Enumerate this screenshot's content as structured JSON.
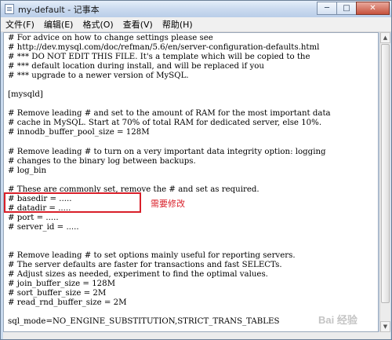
{
  "window": {
    "title": "my-default - 记事本",
    "controls": {
      "minimize": "─",
      "maximize": "□",
      "close": "✕"
    }
  },
  "menu": [
    {
      "label": "文件(F)"
    },
    {
      "label": "编辑(E)"
    },
    {
      "label": "格式(O)"
    },
    {
      "label": "查看(V)"
    },
    {
      "label": "帮助(H)"
    }
  ],
  "editor": {
    "lines": [
      "# For advice on how to change settings please see",
      "# http://dev.mysql.com/doc/refman/5.6/en/server-configuration-defaults.html",
      "# *** DO NOT EDIT THIS FILE. It's a template which will be copied to the",
      "# *** default location during install, and will be replaced if you",
      "# *** upgrade to a newer version of MySQL.",
      "",
      "[mysqld]",
      "",
      "# Remove leading # and set to the amount of RAM for the most important data",
      "# cache in MySQL. Start at 70% of total RAM for dedicated server, else 10%.",
      "# innodb_buffer_pool_size = 128M",
      "",
      "# Remove leading # to turn on a very important data integrity option: logging",
      "# changes to the binary log between backups.",
      "# log_bin",
      "",
      "# These are commonly set, remove the # and set as required.",
      "# basedir = .....",
      "# datadir = .....",
      "# port = .....",
      "# server_id = .....",
      "",
      "",
      "# Remove leading # to set options mainly useful for reporting servers.",
      "# The server defaults are faster for transactions and fast SELECTs.",
      "# Adjust sizes as needed, experiment to find the optimal values.",
      "# join_buffer_size = 128M",
      "# sort_buffer_size = 2M",
      "# read_rnd_buffer_size = 2M",
      "",
      "sql_mode=NO_ENGINE_SUBSTITUTION,STRICT_TRANS_TABLES"
    ]
  },
  "annotation": {
    "text": "需要修改",
    "color": "#d9202a"
  },
  "watermark": {
    "text": "Bai  经验"
  },
  "colors": {
    "titlebar": "#cddcf0",
    "highlight": "#d9202a"
  }
}
